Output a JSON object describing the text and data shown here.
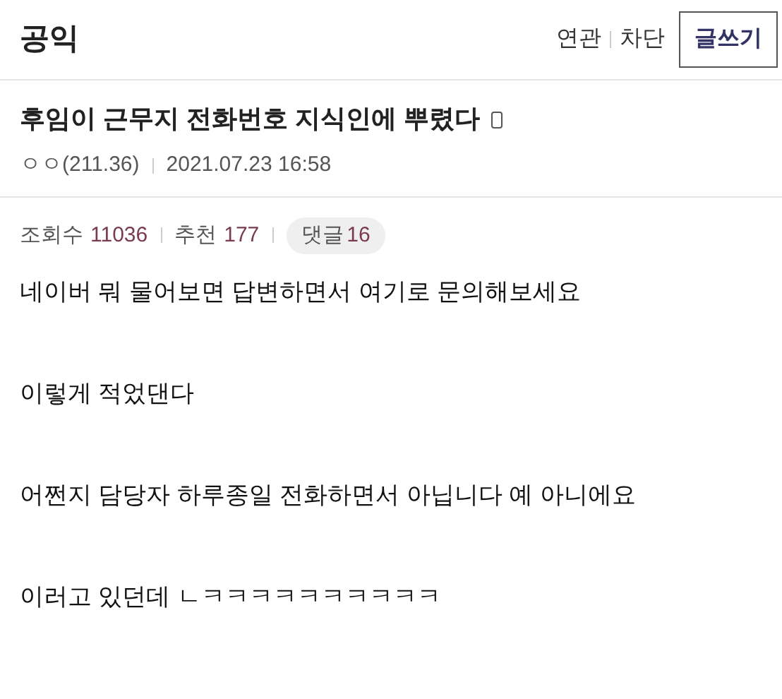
{
  "board": {
    "title": "공익",
    "links": [
      "연관",
      "차단"
    ],
    "write_button": "글쓰기"
  },
  "post": {
    "title": "후임이 근무지 전화번호 지식인에 뿌렸다",
    "mobile": true,
    "author": "ㅇㅇ(211.36)",
    "date": "2021.07.23 16:58",
    "stats": [
      {
        "kind": "plain",
        "label": "조회수",
        "value": "11036"
      },
      {
        "kind": "plain",
        "label": "추천",
        "value": "177"
      },
      {
        "kind": "pill",
        "label": "댓글",
        "value": "16"
      }
    ],
    "body": [
      "네이버 뭐 물어보면 답변하면서 여기로 문의해보세요",
      "이렇게 적었댄다",
      "어쩐지 담당자 하루종일 전화하면서 아닙니다 예 아니에요",
      "이러고 있던데 ㄴㅋㅋㅋㅋㅋㅋㅋㅋㅋㅋ"
    ]
  }
}
